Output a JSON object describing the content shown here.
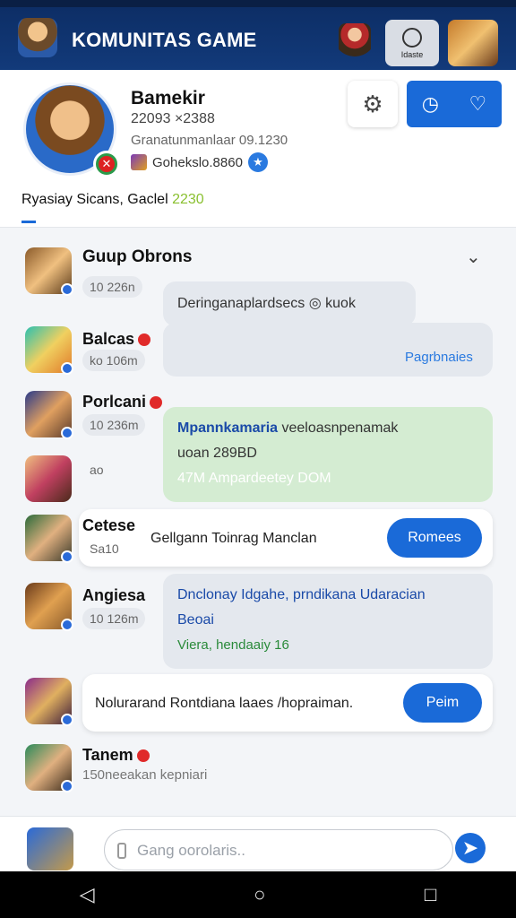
{
  "app": {
    "title": "KOMUNITAS GAME"
  },
  "header": {
    "lang_label": "Idaste"
  },
  "profile": {
    "name": "Bamekir",
    "line1": "22093 ×2388",
    "line2": "Granatunmanlaar 09.1230",
    "line3": "Gohekslo.8860",
    "stats_text": "Ryasiay Sicans, Gaclel",
    "stats_num": "2230"
  },
  "chat": {
    "header": "Guup Obrons",
    "rows": [
      {
        "name": "",
        "meta": "10 226n",
        "bubble": "Deringanaplardsecs ◎ kuok"
      },
      {
        "name": "Balcas",
        "meta": "ko 106m",
        "link": "Pagrbnaies"
      },
      {
        "name": "Porlcani",
        "meta": "10 236m",
        "bubble1": "Mpannkamaria",
        "bubble1b": "veeloasnpenamak",
        "bubble2": "uoan",
        "bubble2b": "289BD",
        "bubble3": "47M",
        "bubble3b": "Ampardeetey DOM"
      },
      {
        "name": "",
        "meta": "ao"
      },
      {
        "name": "Cetese",
        "meta": "Sa10",
        "bubble": "Gellgann",
        "bubble_b": "Toinrag Manclan",
        "btn": "Romees"
      },
      {
        "name": "Angiesa",
        "meta": "10 126m",
        "bubble1": "Dnclonay Idgahe, prndikana Udaracian",
        "bubble2": "Beoai",
        "bubble3": "Viera, hendaaiy 16"
      },
      {
        "name": "",
        "bubble": "Nolurarand",
        "bubble_b": "Rontdiana laaes /hopraiman.",
        "btn": "Peim"
      },
      {
        "name": "Tanem",
        "meta": "150neeakan",
        "meta_b": "kepniari"
      }
    ]
  },
  "composer": {
    "placeholder": "Gang oorolaris.."
  },
  "icons": [
    "gear-icon",
    "clock-icon",
    "heart-icon",
    "send-icon",
    "back-icon",
    "home-icon",
    "recent-icon",
    "chevron-down-icon"
  ]
}
